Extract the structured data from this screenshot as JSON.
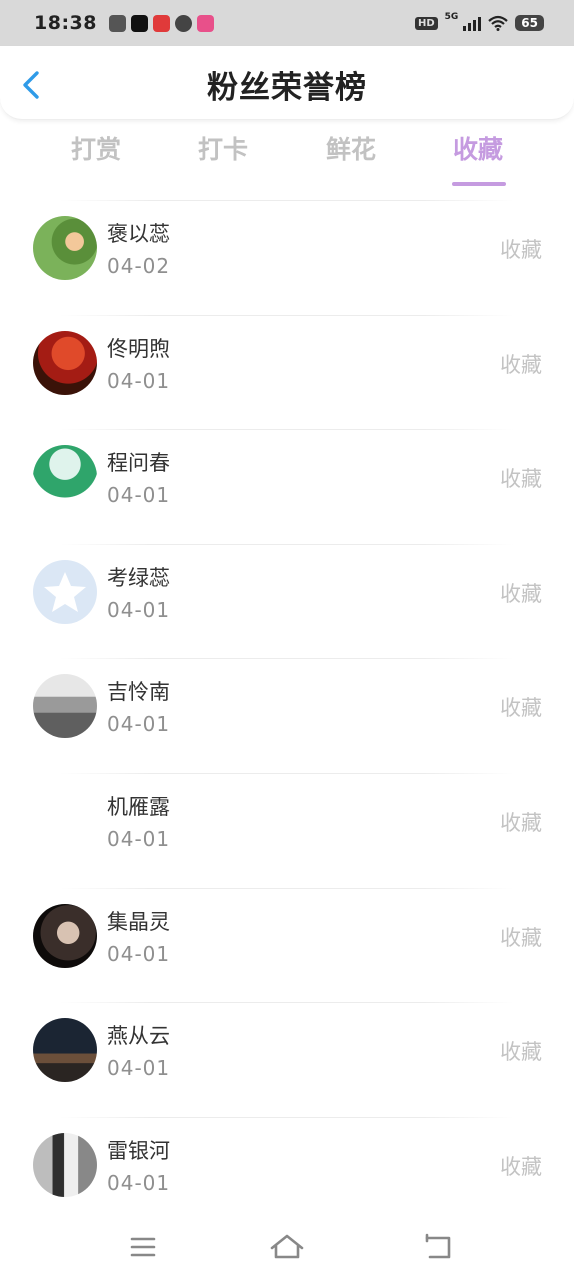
{
  "status_bar": {
    "time": "18:38",
    "network": "5G",
    "hd_label": "HD",
    "battery": "65"
  },
  "header": {
    "title": "粉丝荣誉榜",
    "back_icon": "chevron-left-icon",
    "accent_color": "#2f9be8"
  },
  "tabs": [
    {
      "label": "打赏",
      "active": false
    },
    {
      "label": "打卡",
      "active": false
    },
    {
      "label": "鲜花",
      "active": false
    },
    {
      "label": "收藏",
      "active": true
    }
  ],
  "active_color": "#c59be0",
  "list": [
    {
      "name": "褒以蕊",
      "date": "04-02",
      "action": "收藏"
    },
    {
      "name": "佟明煦",
      "date": "04-01",
      "action": "收藏"
    },
    {
      "name": "程问春",
      "date": "04-01",
      "action": "收藏"
    },
    {
      "name": "考绿蕊",
      "date": "04-01",
      "action": "收藏"
    },
    {
      "name": "吉怜南",
      "date": "04-01",
      "action": "收藏"
    },
    {
      "name": "机雁露",
      "date": "04-01",
      "action": "收藏"
    },
    {
      "name": "集晶灵",
      "date": "04-01",
      "action": "收藏"
    },
    {
      "name": "燕从云",
      "date": "04-01",
      "action": "收藏"
    },
    {
      "name": "雷银河",
      "date": "04-01",
      "action": "收藏"
    }
  ],
  "nav_bar": {
    "menu_icon": "menu-icon",
    "home_icon": "home-icon",
    "back_icon": "back-icon"
  }
}
